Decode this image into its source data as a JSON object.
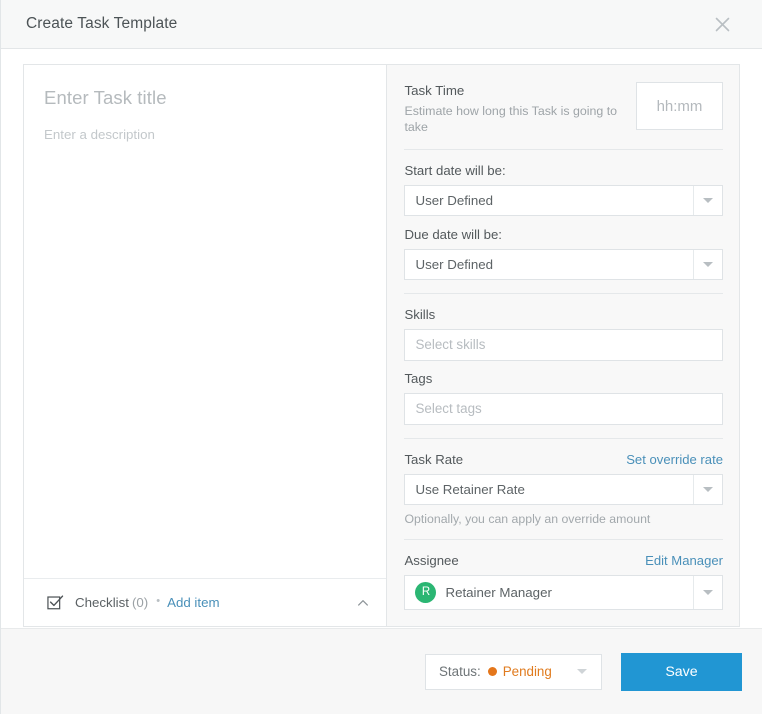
{
  "header": {
    "title": "Create Task Template",
    "close_icon": "close-icon"
  },
  "left_pane": {
    "title_placeholder": "Enter Task title",
    "description_placeholder": "Enter a description",
    "checklist": {
      "icon": "checklist-check-icon",
      "label": "Checklist",
      "count": "(0)",
      "separator": "•",
      "add_item_label": "Add item",
      "collapse_icon": "chevron-up-icon"
    }
  },
  "right_pane": {
    "task_time": {
      "title": "Task Time",
      "subtitle": "Estimate how long this Task is going to take",
      "input_placeholder": "hh:mm"
    },
    "start_date": {
      "label": "Start date will be:",
      "value": "User Defined"
    },
    "due_date": {
      "label": "Due date will be:",
      "value": "User Defined"
    },
    "skills": {
      "label": "Skills",
      "placeholder": "Select skills"
    },
    "tags": {
      "label": "Tags",
      "placeholder": "Select tags"
    },
    "task_rate": {
      "label": "Task Rate",
      "link": "Set override rate",
      "value": "Use Retainer Rate",
      "hint": "Optionally, you can apply an override amount"
    },
    "assignee": {
      "label": "Assignee",
      "link": "Edit Manager",
      "avatar_initial": "R",
      "value": "Retainer Manager"
    }
  },
  "footer": {
    "status_label": "Status:",
    "status_value": "Pending",
    "save_label": "Save"
  },
  "colors": {
    "accent_blue": "#2196d3",
    "link_blue": "#4a90b9",
    "status_orange": "#e07b1e",
    "avatar_green": "#2bb673"
  }
}
